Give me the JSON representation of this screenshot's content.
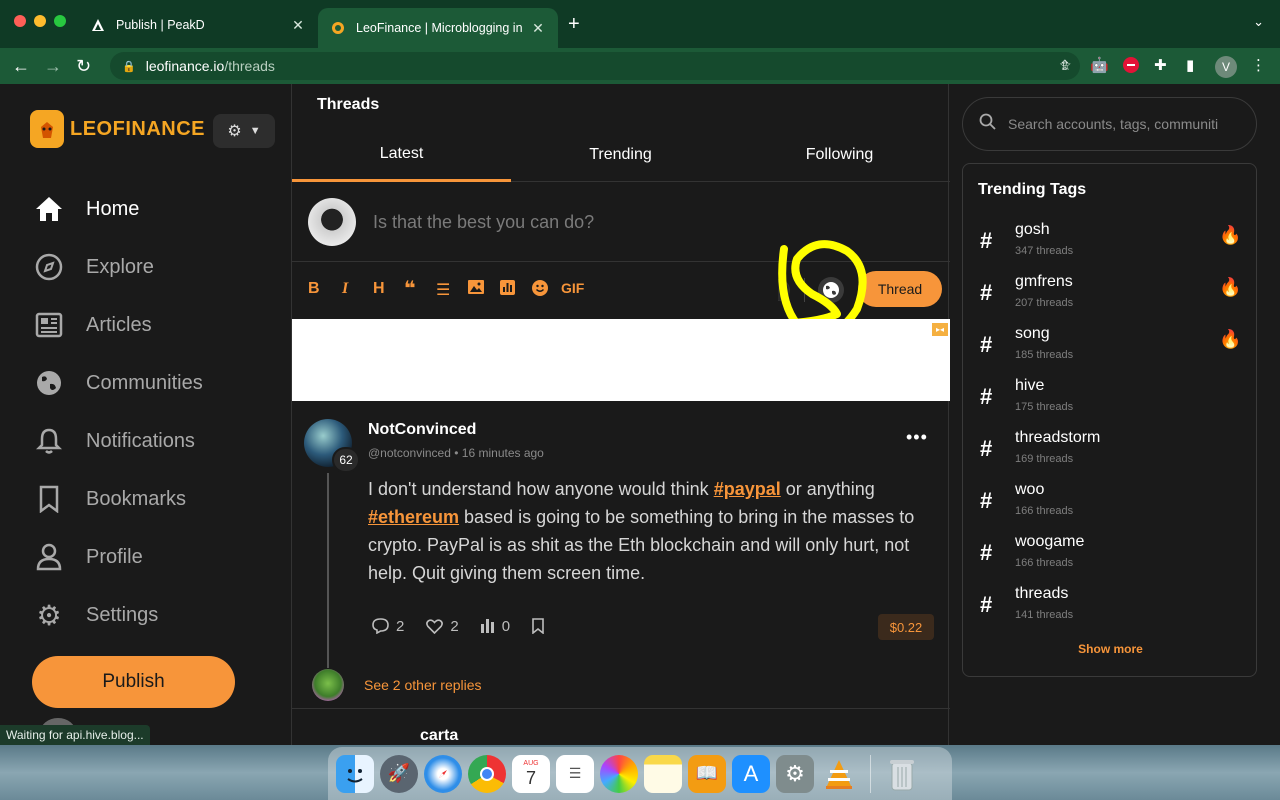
{
  "browser": {
    "tabs": [
      {
        "title": "Publish | PeakD",
        "favicon": "peakd-icon"
      },
      {
        "title": "LeoFinance | Microblogging in",
        "favicon": "leofinance-icon"
      }
    ],
    "new_tab_symbol": "+",
    "url_domain": "leofinance.io",
    "url_path": "/threads",
    "profile_initial": "V",
    "status_text": "Waiting for api.hive.blog..."
  },
  "sidebar": {
    "logo_text": "LEOFINANCE",
    "items": [
      {
        "label": "Home",
        "icon": "home-icon",
        "active": true
      },
      {
        "label": "Explore",
        "icon": "compass-icon",
        "active": false
      },
      {
        "label": "Articles",
        "icon": "newspaper-icon",
        "active": false
      },
      {
        "label": "Communities",
        "icon": "globe-icon",
        "active": false
      },
      {
        "label": "Notifications",
        "icon": "bell-icon",
        "active": false
      },
      {
        "label": "Bookmarks",
        "icon": "bookmark-icon",
        "active": false
      },
      {
        "label": "Profile",
        "icon": "user-icon",
        "active": false
      },
      {
        "label": "Settings",
        "icon": "gear-icon",
        "active": false
      }
    ],
    "publish_label": "Publish"
  },
  "main": {
    "title": "Threads",
    "tabs": [
      {
        "label": "Latest",
        "active": true
      },
      {
        "label": "Trending",
        "active": false
      },
      {
        "label": "Following",
        "active": false
      }
    ],
    "composer_placeholder": "Is that the best you can do?",
    "format_tools": [
      "B",
      "I",
      "H",
      "quote",
      "list",
      "image",
      "poll",
      "emoji",
      "GIF"
    ],
    "gif_label": "GIF",
    "thread_button": "Thread",
    "post": {
      "author": "NotConvinced",
      "handle": "@notconvinced",
      "time": "16 minutes ago",
      "reputation": "62",
      "body_pre": "I don't understand how anyone would think ",
      "tag1": "#paypal",
      "body_mid": " or anything ",
      "tag2": "#ethereum",
      "body_post": " based is going to be something to bring in the masses to crypto. PayPal is as shit as the Eth blockchain and will only hurt, not help. Quit giving them screen time.",
      "comments": "2",
      "likes": "2",
      "views": "0",
      "payout": "$0.22",
      "see_replies": "See 2 other replies"
    },
    "next_post_fragment": "carta"
  },
  "right": {
    "search_placeholder": "Search accounts, tags, communiti",
    "trending_title": "Trending Tags",
    "tags": [
      {
        "name": "gosh",
        "count": "347 threads",
        "hot": true
      },
      {
        "name": "gmfrens",
        "count": "207 threads",
        "hot": true
      },
      {
        "name": "song",
        "count": "185 threads",
        "hot": true
      },
      {
        "name": "hive",
        "count": "175 threads",
        "hot": false
      },
      {
        "name": "threadstorm",
        "count": "169 threads",
        "hot": false
      },
      {
        "name": "woo",
        "count": "166 threads",
        "hot": false
      },
      {
        "name": "woogame",
        "count": "166 threads",
        "hot": false
      },
      {
        "name": "threads",
        "count": "141 threads",
        "hot": false
      }
    ],
    "show_more": "Show more"
  },
  "dock": {
    "calendar_month": "AUG",
    "calendar_day": "7",
    "apps": [
      "finder-icon",
      "launchpad-icon",
      "safari-icon",
      "chrome-icon",
      "calendar-icon",
      "reminders-icon",
      "photos-icon",
      "notes-icon",
      "books-icon",
      "appstore-icon",
      "system-preferences-icon",
      "vlc-icon",
      "trash-icon"
    ]
  },
  "colors": {
    "accent": "#f7953a",
    "browser_green": "#1c5a37",
    "tab_bar": "#0f3a25",
    "background": "#1a1a1a",
    "highlight_annotation": "#ffff00"
  }
}
